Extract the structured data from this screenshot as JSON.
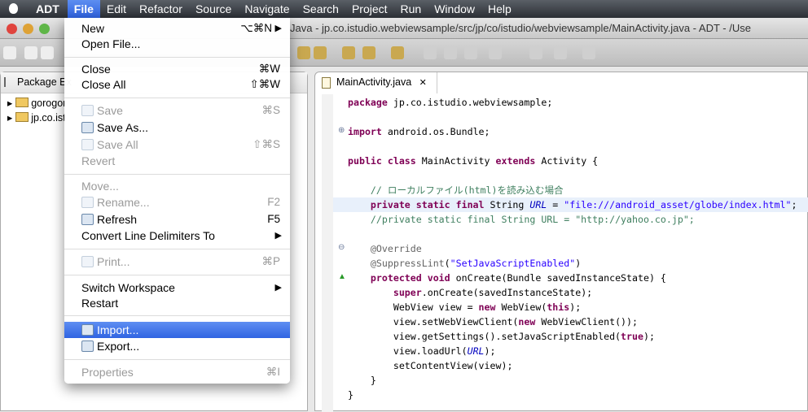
{
  "menubar": {
    "items": [
      "ADT",
      "File",
      "Edit",
      "Refactor",
      "Source",
      "Navigate",
      "Search",
      "Project",
      "Run",
      "Window",
      "Help"
    ],
    "selected": "File"
  },
  "window": {
    "title": "Java - jp.co.istudio.webviewsample/src/jp/co/istudio/webviewsample/MainActivity.java - ADT - /Use"
  },
  "package_explorer": {
    "title": "Package Ex",
    "items": [
      "gorogor",
      "jp.co.ist"
    ]
  },
  "editor": {
    "tab": "MainActivity.java",
    "lines": [
      [
        [
          "kw",
          "package"
        ],
        [
          "",
          "jp.co.istudio.webviewsample;"
        ]
      ],
      [],
      [
        [
          "kw",
          "import"
        ],
        [
          "",
          " android.os.Bundle;"
        ]
      ],
      [],
      [
        [
          "kw",
          "public class"
        ],
        [
          "",
          " MainActivity "
        ],
        [
          "kw",
          "extends"
        ],
        [
          "",
          " Activity {"
        ]
      ],
      [],
      [
        [
          "",
          "    "
        ],
        [
          "cm",
          "// ローカルファイル(html)を読み込む場合"
        ]
      ],
      [
        [
          "",
          "    "
        ],
        [
          "kw",
          "private static final"
        ],
        [
          "",
          " String "
        ],
        [
          "it",
          "URL"
        ],
        [
          "",
          " = "
        ],
        [
          "str",
          "\"file:///android_asset/globe/index.html\""
        ],
        [
          "",
          ";"
        ]
      ],
      [
        [
          "",
          "    "
        ],
        [
          "cm",
          "//private static final String URL = \"http://yahoo.co.jp\";"
        ]
      ],
      [],
      [
        [
          "",
          "    "
        ],
        [
          "an",
          "@Override"
        ]
      ],
      [
        [
          "",
          "    "
        ],
        [
          "an",
          "@SuppressLint"
        ],
        [
          "",
          "("
        ],
        [
          "str",
          "\"SetJavaScriptEnabled\""
        ],
        [
          "",
          ")"
        ]
      ],
      [
        [
          "",
          "    "
        ],
        [
          "kw",
          "protected void"
        ],
        [
          "",
          " onCreate(Bundle savedInstanceState) {"
        ]
      ],
      [
        [
          "",
          "        "
        ],
        [
          "kw",
          "super"
        ],
        [
          "",
          ".onCreate(savedInstanceState);"
        ]
      ],
      [
        [
          "",
          "        WebView view = "
        ],
        [
          "kw",
          "new"
        ],
        [
          "",
          " WebView("
        ],
        [
          "kw",
          "this"
        ],
        [
          "",
          ");"
        ]
      ],
      [
        [
          "",
          "        view.setWebViewClient("
        ],
        [
          "kw",
          "new"
        ],
        [
          "",
          " WebViewClient());"
        ]
      ],
      [
        [
          "",
          "        view.getSettings().setJavaScriptEnabled("
        ],
        [
          "kw",
          "true"
        ],
        [
          "",
          ");"
        ]
      ],
      [
        [
          "",
          "        view.loadUrl("
        ],
        [
          "it",
          "URL"
        ],
        [
          "",
          ");"
        ]
      ],
      [
        [
          "",
          "        setContentView(view);"
        ]
      ],
      [
        [
          "",
          "    }"
        ]
      ],
      [
        [
          "",
          "}"
        ]
      ]
    ]
  },
  "file_menu": {
    "items": [
      {
        "label": "New",
        "shortcut": "⌥⌘N",
        "submenu": true
      },
      {
        "label": "Open File..."
      },
      {
        "label": "Close",
        "shortcut": "⌘W"
      },
      {
        "label": "Close All",
        "shortcut": "⇧⌘W"
      },
      {
        "label": "Save",
        "shortcut": "⌘S",
        "disabled": true,
        "icon": "save-icon"
      },
      {
        "label": "Save As...",
        "icon": "save-as-icon"
      },
      {
        "label": "Save All",
        "shortcut": "⇧⌘S",
        "disabled": true,
        "icon": "save-all-icon"
      },
      {
        "label": "Revert",
        "disabled": true
      },
      {
        "label": "Move...",
        "disabled": true
      },
      {
        "label": "Rename...",
        "shortcut": "F2",
        "disabled": true,
        "icon": "rename-icon"
      },
      {
        "label": "Refresh",
        "shortcut": "F5",
        "icon": "refresh-icon"
      },
      {
        "label": "Convert Line Delimiters To",
        "submenu": true
      },
      {
        "label": "Print...",
        "shortcut": "⌘P",
        "disabled": true,
        "icon": "print-icon"
      },
      {
        "label": "Switch Workspace",
        "submenu": true
      },
      {
        "label": "Restart"
      },
      {
        "label": "Import...",
        "highlighted": true,
        "icon": "import-icon"
      },
      {
        "label": "Export...",
        "icon": "export-icon"
      },
      {
        "label": "Properties",
        "shortcut": "⌘I",
        "disabled": true
      }
    ]
  }
}
